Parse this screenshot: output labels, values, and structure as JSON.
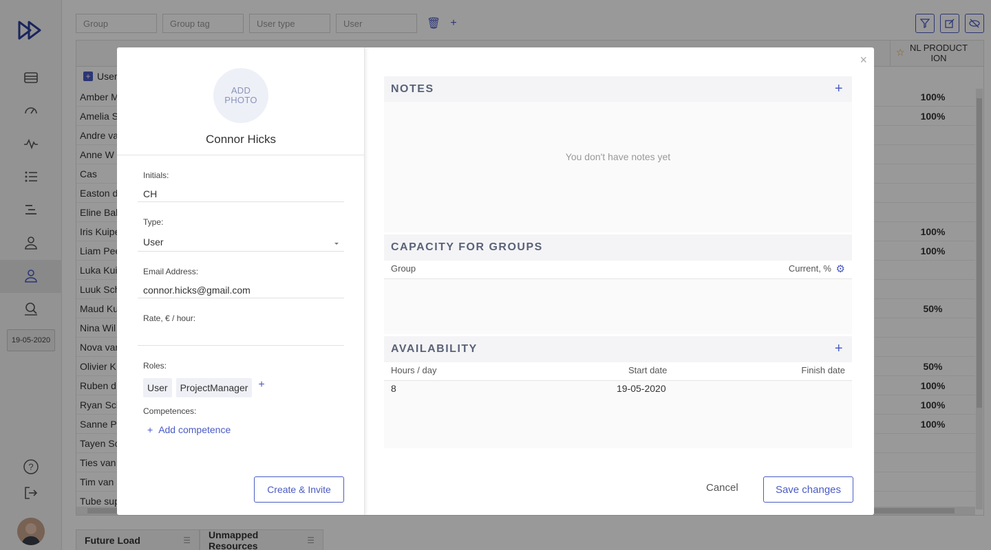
{
  "colors": {
    "accent": "#4a5bc4",
    "overlay": "rgba(0,0,0,0.40)",
    "star": "#e2a030"
  },
  "sidebar": {
    "logo_icon": "double-play-logo",
    "items": [
      {
        "icon": "list-icon"
      },
      {
        "icon": "speedometer-icon"
      },
      {
        "icon": "activity-icon"
      },
      {
        "icon": "numbered-list-icon"
      },
      {
        "icon": "gantt-icon"
      },
      {
        "icon": "user-icon"
      },
      {
        "icon": "users-icon"
      },
      {
        "icon": "search-user-icon"
      }
    ],
    "date": "19-05-2020",
    "help_icon": "help-icon",
    "logout_icon": "logout-icon"
  },
  "filters": {
    "group_placeholder": "Group",
    "group_tag_placeholder": "Group tag",
    "user_type_placeholder": "User type",
    "user_placeholder": "User"
  },
  "grid": {
    "user_column": "User",
    "nl_header": "NL PRODUCT ION",
    "rows": [
      {
        "name": "Amber M",
        "pct": "100%"
      },
      {
        "name": "Amelia S",
        "pct": "100%"
      },
      {
        "name": "Andre va",
        "pct": ""
      },
      {
        "name": "Anne W",
        "pct": ""
      },
      {
        "name": "Cas",
        "pct": ""
      },
      {
        "name": "Easton d",
        "pct": ""
      },
      {
        "name": "Eline Bal",
        "pct": ""
      },
      {
        "name": "Iris Kuipe",
        "pct": "100%"
      },
      {
        "name": "Liam Pee",
        "pct": "100%"
      },
      {
        "name": "Luka Kui",
        "pct": ""
      },
      {
        "name": "Luuk Sch",
        "pct": ""
      },
      {
        "name": "Maud Ku",
        "pct": "50%"
      },
      {
        "name": "Nina Wil",
        "pct": ""
      },
      {
        "name": "Nova var",
        "pct": ""
      },
      {
        "name": "Olivier K",
        "pct": "50%"
      },
      {
        "name": "Ruben d",
        "pct": "100%"
      },
      {
        "name": "Ryan Sch",
        "pct": "100%"
      },
      {
        "name": "Sanne Pe",
        "pct": "100%"
      },
      {
        "name": "Tayen Sc",
        "pct": ""
      },
      {
        "name": "Ties van",
        "pct": ""
      },
      {
        "name": "Tim van",
        "pct": ""
      },
      {
        "name": "Tube sup",
        "pct": ""
      }
    ]
  },
  "bottom_tabs": [
    "Future Load",
    "Unmapped Resources"
  ],
  "modal": {
    "photo_label": "ADD PHOTO",
    "user_name": "Connor Hicks",
    "initials_label": "Initials:",
    "initials_value": "CH",
    "type_label": "Type:",
    "type_value": "User",
    "email_label": "Email Address:",
    "email_value": "connor.hicks@gmail.com",
    "rate_label": "Rate, € / hour:",
    "rate_value": "",
    "roles_label": "Roles:",
    "roles": [
      "User",
      "ProjectManager"
    ],
    "competences_label": "Competences:",
    "add_competence": "Add competence",
    "create_invite": "Create & Invite",
    "notes_title": "NOTES",
    "notes_empty": "You don't have notes yet",
    "capacity_title": "CAPACITY FOR GROUPS",
    "capacity_col_group": "Group",
    "capacity_col_current": "Current, %",
    "availability_title": "AVAILABILITY",
    "avail_col_hours": "Hours / day",
    "avail_col_start": "Start date",
    "avail_col_finish": "Finish date",
    "avail_row": {
      "hours": "8",
      "start": "19-05-2020",
      "finish": ""
    },
    "cancel": "Cancel",
    "save": "Save changes"
  }
}
